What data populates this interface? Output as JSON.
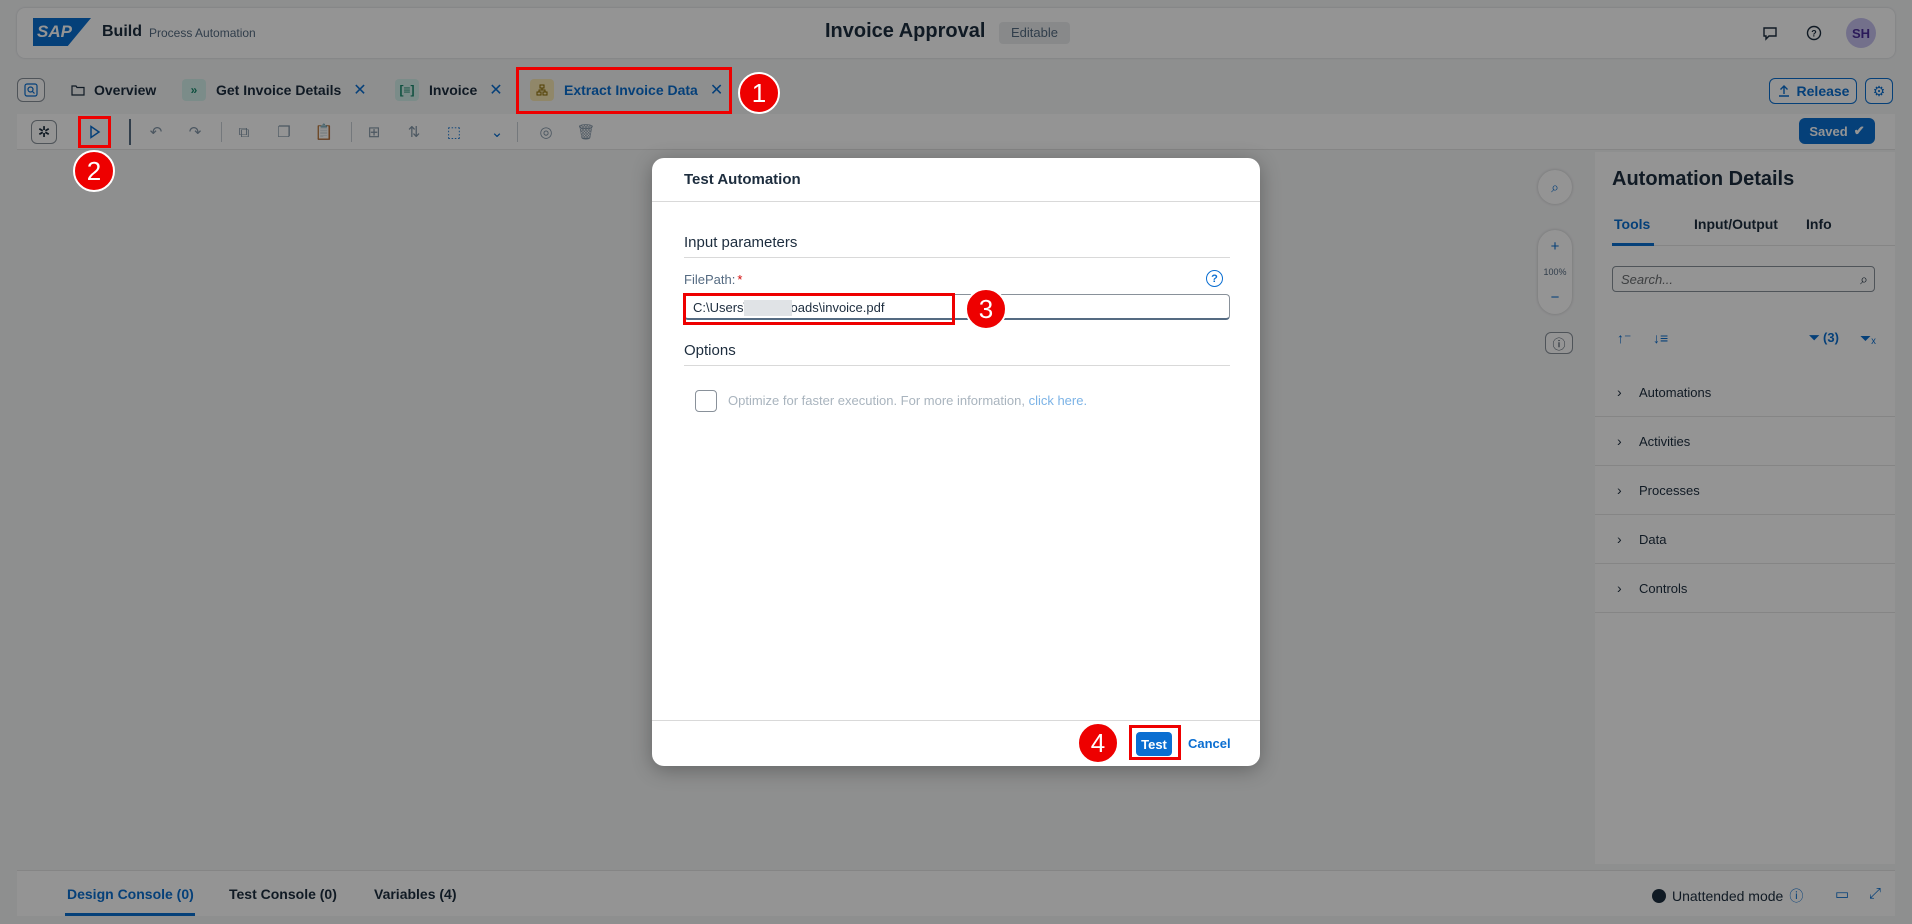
{
  "shell": {
    "logo": "SAP",
    "brand": "Build",
    "product": "Process Automation",
    "title": "Invoice Approval",
    "badge": "Editable",
    "avatar": "SH"
  },
  "tabs": {
    "items": [
      {
        "label": "Overview"
      },
      {
        "label": "Get Invoice Details"
      },
      {
        "label": "Invoice"
      },
      {
        "label": "Extract Invoice Data"
      }
    ],
    "release_label": "Release"
  },
  "toolbar": {
    "saved_label": "Saved"
  },
  "canvas": {
    "zoom": "100%"
  },
  "right_panel": {
    "title": "Automation Details",
    "tabs": [
      "Tools",
      "Input/Output",
      "Info"
    ],
    "search_placeholder": "Search...",
    "filter_label": "(3)",
    "items": [
      "Automations",
      "Activities",
      "Processes",
      "Data",
      "Controls"
    ]
  },
  "bottom": {
    "tabs": [
      "Design Console (0)",
      "Test Console (0)",
      "Variables (4)"
    ],
    "mode": "Unattended mode"
  },
  "dialog": {
    "title": "Test Automation",
    "input_section": "Input parameters",
    "filepath_label": "FilePath:",
    "required_mark": "*",
    "filepath_value": "C:\\Users\\        \\Downloads\\invoice.pdf",
    "options_section": "Options",
    "option_text": "Optimize for faster execution. For more information, ",
    "option_link": "click here.",
    "test_label": "Test",
    "cancel_label": "Cancel"
  },
  "annotations": [
    "1",
    "2",
    "3",
    "4"
  ],
  "colors": {
    "accent": "#0a6ed1",
    "annotation": "#ee0000"
  }
}
